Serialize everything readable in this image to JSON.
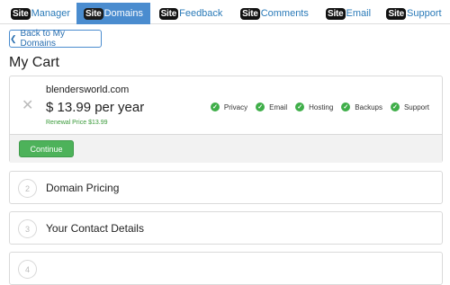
{
  "tabs": [
    {
      "badge": "Site",
      "label": "Manager"
    },
    {
      "badge": "Site",
      "label": "Domains"
    },
    {
      "badge": "Site",
      "label": "Feedback"
    },
    {
      "badge": "Site",
      "label": "Comments"
    },
    {
      "badge": "Site",
      "label": "Email"
    },
    {
      "badge": "Site",
      "label": "Support"
    }
  ],
  "active_tab": "Domains",
  "back_button": "Back to My Domains",
  "page_title": "My Cart",
  "cart": {
    "domain": "blendersworld.com",
    "price": "$ 13.99 per year",
    "renewal": "Renewal Price $13.99",
    "features": [
      "Privacy",
      "Email",
      "Hosting",
      "Backups",
      "Support"
    ],
    "continue_label": "Continue"
  },
  "steps": [
    {
      "num": "2",
      "label": "Domain Pricing"
    },
    {
      "num": "3",
      "label": "Your Contact Details"
    },
    {
      "num": "4",
      "label": ""
    }
  ],
  "colors": {
    "accent": "#4a8ccf",
    "success": "#4db25a"
  }
}
